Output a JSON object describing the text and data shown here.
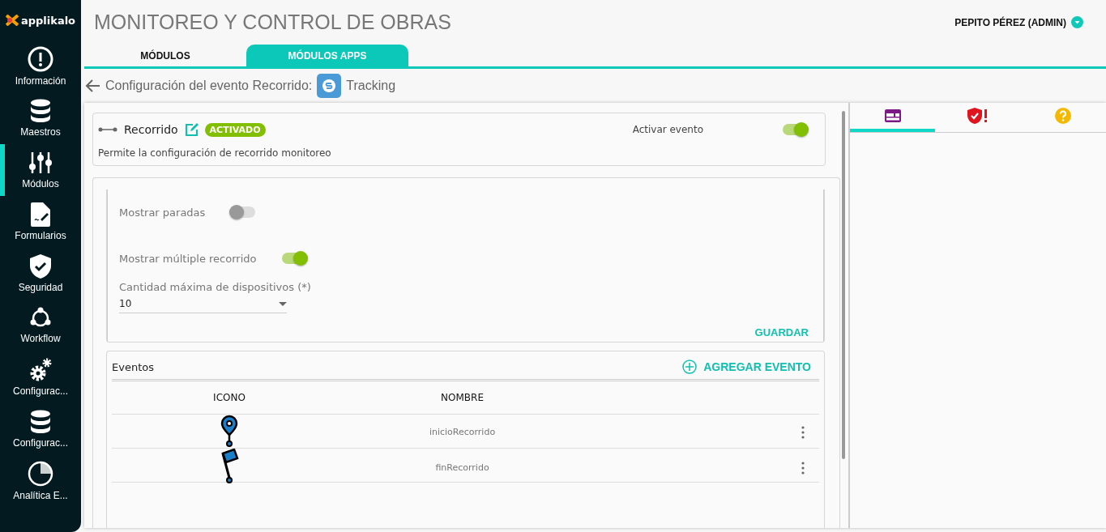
{
  "app": {
    "logo": "applikalo"
  },
  "sidebar": {
    "items": [
      {
        "kind": "info",
        "label": "Información",
        "selected": false
      },
      {
        "kind": "database",
        "label": "Maestros",
        "selected": false
      },
      {
        "kind": "sliders",
        "label": "Módulos",
        "selected": true
      },
      {
        "kind": "form",
        "label": "Formularios",
        "selected": false
      },
      {
        "kind": "shield",
        "label": "Seguridad",
        "selected": false
      },
      {
        "kind": "workflow",
        "label": "Workflow",
        "selected": false
      },
      {
        "kind": "gears",
        "label": "Configurac...",
        "selected": false
      },
      {
        "kind": "database",
        "label": "Configurac...",
        "selected": false
      },
      {
        "kind": "pie",
        "label": "Analítica E...",
        "selected": false
      }
    ]
  },
  "header": {
    "title": "MONITOREO Y CONTROL DE OBRAS",
    "user": "PEPITO PÉREZ (ADMIN)"
  },
  "tabs": [
    {
      "label": "MÓDULOS",
      "selected": false
    },
    {
      "label": "MÓDULOS APPS",
      "selected": true
    }
  ],
  "breadcrumb": {
    "text": "Configuración del evento Recorrido:",
    "app": "Tracking"
  },
  "event_card": {
    "name": "Recorrido",
    "status": "ACTIVADO",
    "description": "Permite la configuración de recorrido monitoreo",
    "toggle_label": "Activar evento",
    "on": true
  },
  "settings": {
    "switches": [
      {
        "label": "Mostrar paradas",
        "on": false
      },
      {
        "label": "Mostrar múltiple recorrido",
        "on": true
      }
    ],
    "select": {
      "label": "Cantidad máxima de dispositivos (*)",
      "value": "10"
    },
    "save": "GUARDAR"
  },
  "events": {
    "title": "Eventos",
    "add": "AGREGAR EVENTO",
    "columns": [
      "ICONO",
      "NOMBRE"
    ],
    "rows": [
      {
        "kind": "pin",
        "name": "inicioRecorrido"
      },
      {
        "kind": "flag",
        "name": "finRecorrido"
      }
    ]
  },
  "right_panel": {
    "tabs": [
      {
        "kind": "card",
        "selected": true
      },
      {
        "kind": "shield",
        "selected": false
      },
      {
        "kind": "help",
        "selected": false
      }
    ]
  }
}
